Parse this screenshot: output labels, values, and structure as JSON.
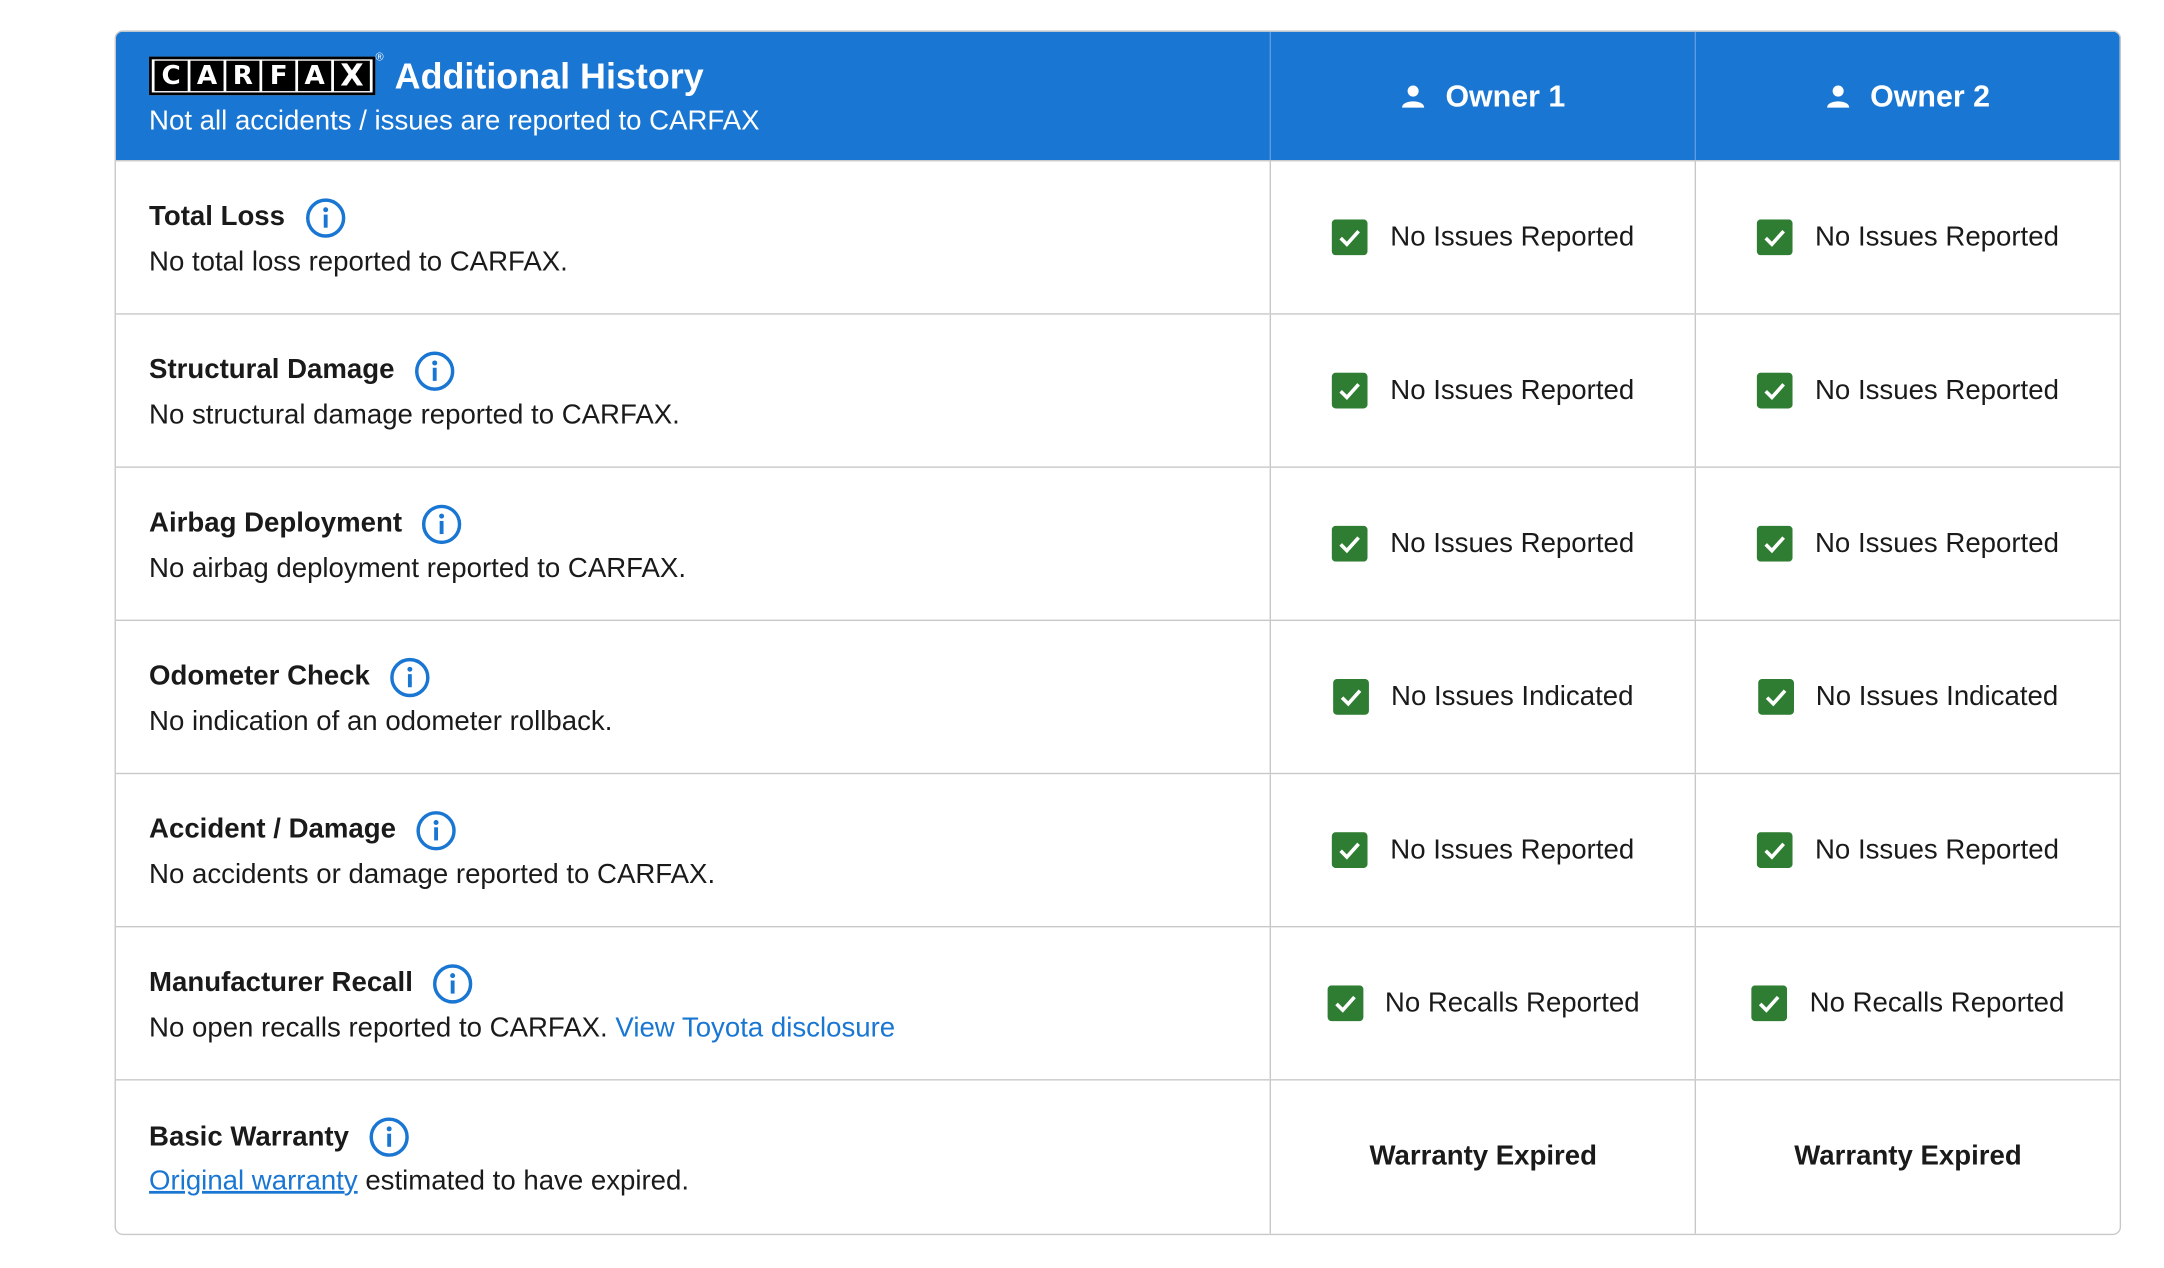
{
  "header": {
    "logo_letters": [
      "C",
      "A",
      "R",
      "F",
      "A",
      "X"
    ],
    "title": "Additional History",
    "subtitle": "Not all accidents / issues are reported to CARFAX",
    "owners": [
      "Owner 1",
      "Owner 2"
    ],
    "bg_color": "#1976d2"
  },
  "rows": [
    {
      "title": "Total Loss",
      "desc": "No total loss reported to CARFAX.",
      "owner1": "No Issues Reported",
      "owner2": "No Issues Reported"
    },
    {
      "title": "Structural Damage",
      "desc": "No structural damage reported to CARFAX.",
      "owner1": "No Issues Reported",
      "owner2": "No Issues Reported"
    },
    {
      "title": "Airbag Deployment",
      "desc": "No airbag deployment reported to CARFAX.",
      "owner1": "No Issues Reported",
      "owner2": "No Issues Reported"
    },
    {
      "title": "Odometer Check",
      "desc": "No indication of an odometer rollback.",
      "owner1": "No Issues Indicated",
      "owner2": "No Issues Indicated"
    },
    {
      "title": "Accident / Damage",
      "desc": "No accidents or damage reported to CARFAX.",
      "owner1": "No Issues Reported",
      "owner2": "No Issues Reported"
    },
    {
      "title": "Manufacturer Recall",
      "desc": "No open recalls reported to CARFAX.",
      "link": "View Toyota disclosure",
      "owner1": "No Recalls Reported",
      "owner2": "No Recalls Reported"
    },
    {
      "title": "Basic Warranty",
      "link": "Original warranty",
      "desc": "estimated to have expired.",
      "owner1": "Warranty Expired",
      "owner2": "Warranty Expired"
    }
  ],
  "colors": {
    "check": "#2e7d32",
    "link": "#1976d2",
    "border": "#c8c8c8"
  },
  "icons": {
    "info": "info-circle-icon",
    "check": "checkbox-checked-icon",
    "owner": "person-icon"
  }
}
